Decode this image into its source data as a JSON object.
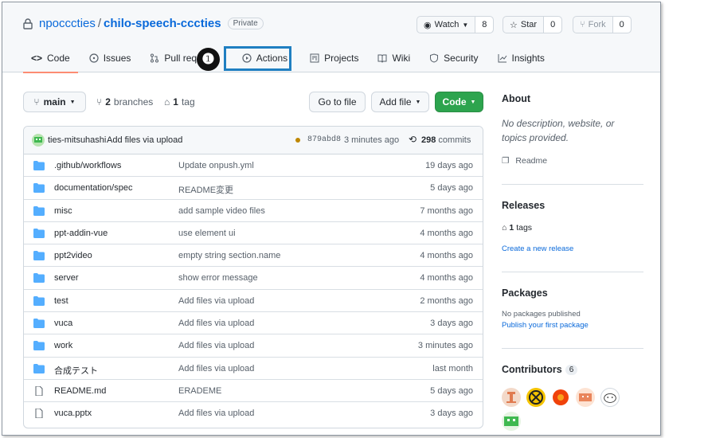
{
  "repo": {
    "owner": "npocccties",
    "separator": "/",
    "name": "chilo-speech-cccties",
    "visibility": "Private"
  },
  "top_actions": {
    "watch": {
      "label": "Watch",
      "count": "8"
    },
    "star": {
      "label": "Star",
      "count": "0"
    },
    "fork": {
      "label": "Fork",
      "count": "0"
    }
  },
  "tabs": [
    {
      "label": "Code",
      "icon": "code-icon"
    },
    {
      "label": "Issues",
      "icon": "issue-icon"
    },
    {
      "label": "Pull requ",
      "icon": "pull-request-icon"
    },
    {
      "label": "Actions",
      "icon": "play-icon"
    },
    {
      "label": "Projects",
      "icon": "project-icon"
    },
    {
      "label": "Wiki",
      "icon": "book-icon"
    },
    {
      "label": "Security",
      "icon": "shield-icon"
    },
    {
      "label": "Insights",
      "icon": "graph-icon"
    }
  ],
  "callout_marker": "❶",
  "toolbar": {
    "branch": "main",
    "branches_count": "2",
    "branches_label": "branches",
    "tags_count": "1",
    "tags_label": "tag",
    "go_to_file": "Go to file",
    "add_file": "Add file",
    "code": "Code"
  },
  "commit": {
    "author": "ties-mitsuhashi",
    "message": "Add files via upload",
    "sha": "879abd8",
    "time": "3 minutes ago",
    "commits_count": "298",
    "commits_label": "commits"
  },
  "files": [
    {
      "type": "dir",
      "name": ".github/workflows",
      "message": "Update onpush.yml",
      "age": "19 days ago"
    },
    {
      "type": "dir",
      "name": "documentation/spec",
      "message": "README変更",
      "age": "5 days ago"
    },
    {
      "type": "dir",
      "name": "misc",
      "message": "add sample video files",
      "age": "7 months ago"
    },
    {
      "type": "dir",
      "name": "ppt-addin-vue",
      "message": "use element ui",
      "age": "4 months ago"
    },
    {
      "type": "dir",
      "name": "ppt2video",
      "message": "empty string section.name",
      "age": "4 months ago"
    },
    {
      "type": "dir",
      "name": "server",
      "message": "show error message",
      "age": "4 months ago"
    },
    {
      "type": "dir",
      "name": "test",
      "message": "Add files via upload",
      "age": "2 months ago"
    },
    {
      "type": "dir",
      "name": "vuca",
      "message": "Add files via upload",
      "age": "3 days ago"
    },
    {
      "type": "dir",
      "name": "work",
      "message": "Add files via upload",
      "age": "3 minutes ago"
    },
    {
      "type": "dir",
      "name": "合成テスト",
      "message": "Add files via upload",
      "age": "last month"
    },
    {
      "type": "file",
      "name": "README.md",
      "message": "ERADEME",
      "age": "5 days ago"
    },
    {
      "type": "file",
      "name": "vuca.pptx",
      "message": "Add files via upload",
      "age": "3 days ago"
    }
  ],
  "sidebar": {
    "about_title": "About",
    "about_text": "No description, website, or topics provided.",
    "readme": "Readme",
    "releases_title": "Releases",
    "tags_count": "1",
    "tags_label": "tags",
    "create_release": "Create a new release",
    "packages_title": "Packages",
    "no_packages": "No packages published",
    "publish_package": "Publish your first package",
    "contributors_title": "Contributors",
    "contributors_count": "6"
  },
  "colors": {
    "link": "#0969da",
    "green_button": "#2da44e",
    "highlight_box": "#1f7fc1",
    "tab_underline": "#fd8c73",
    "folder": "#54aeff"
  }
}
